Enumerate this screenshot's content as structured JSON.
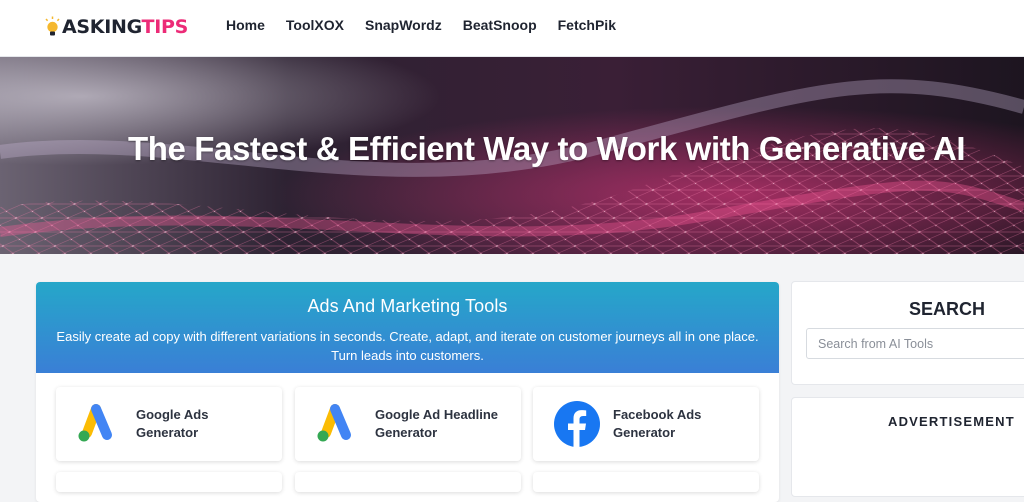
{
  "header": {
    "logo": {
      "part1": "ASKING",
      "part2": "TIPS",
      "icon": "lightbulb-icon"
    },
    "nav": [
      {
        "label": "Home"
      },
      {
        "label": "ToolXOX"
      },
      {
        "label": "SnapWordz"
      },
      {
        "label": "BeatSnoop"
      },
      {
        "label": "FetchPik"
      }
    ]
  },
  "hero": {
    "title": "The Fastest & Efficient Way to Work with Generative AI"
  },
  "section": {
    "title": "Ads And Marketing Tools",
    "description": "Easily create ad copy with different variations in seconds. Create, adapt, and iterate on customer journeys all in one place. Turn leads into customers.",
    "tools": [
      {
        "name": "Google Ads Generator",
        "icon": "google-ads-icon"
      },
      {
        "name": "Google Ad Headline Generator",
        "icon": "google-ads-icon"
      },
      {
        "name": "Facebook Ads Generator",
        "icon": "facebook-icon"
      }
    ]
  },
  "sidebar": {
    "search": {
      "title": "SEARCH",
      "placeholder": "Search from AI Tools"
    },
    "ad": {
      "title": "ADVERTISEMENT"
    }
  },
  "colors": {
    "brand_pink": "#ec2b77",
    "brand_dark": "#1f2430",
    "section_gradient_top": "#25a7c9",
    "section_gradient_bottom": "#3a7fd6",
    "facebook_blue": "#1877f2"
  }
}
